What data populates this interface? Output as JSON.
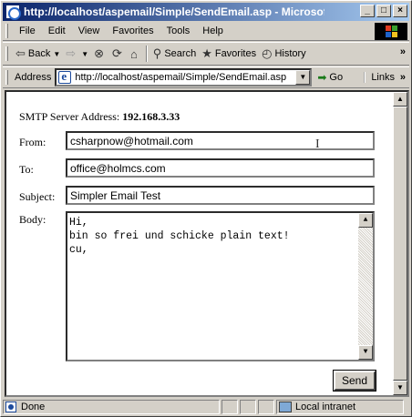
{
  "window": {
    "title": "http://localhost/aspemail/Simple/SendEmail.asp - Microsoft In...",
    "minimize": "_",
    "maximize": "□",
    "close": "×"
  },
  "menu": [
    "File",
    "Edit",
    "View",
    "Favorites",
    "Tools",
    "Help"
  ],
  "toolbar": {
    "back": "Back",
    "search": "Search",
    "favorites": "Favorites",
    "history": "History",
    "more": "»"
  },
  "address": {
    "label": "Address",
    "url": "http://localhost/aspemail/Simple/SendEmail.asp",
    "go": "Go",
    "links": "Links",
    "links_more": "»"
  },
  "form": {
    "smtp_label": "SMTP Server Address:",
    "smtp_value": "192.168.3.33",
    "from_label": "From:",
    "from_value": "csharpnow@hotmail.com",
    "to_label": "To:",
    "to_value": "office@holmcs.com",
    "subject_label": "Subject:",
    "subject_value": "Simpler Email Test",
    "body_label": "Body:",
    "body_lines": [
      "Hi,",
      "bin so frei und schicke plain text!",
      "cu,"
    ],
    "send_label": "Send"
  },
  "status": {
    "text": "Done",
    "zone": "Local intranet"
  },
  "colors": {
    "title_start": "#0a246a",
    "title_end": "#a6caf0",
    "chrome": "#d4d0c8"
  },
  "icons": [
    "ie-page-icon",
    "back-arrow-icon",
    "forward-arrow-icon",
    "stop-icon",
    "refresh-icon",
    "home-icon",
    "search-icon",
    "favorites-icon",
    "history-icon",
    "go-arrow-icon",
    "windows-logo-icon",
    "intranet-icon"
  ]
}
